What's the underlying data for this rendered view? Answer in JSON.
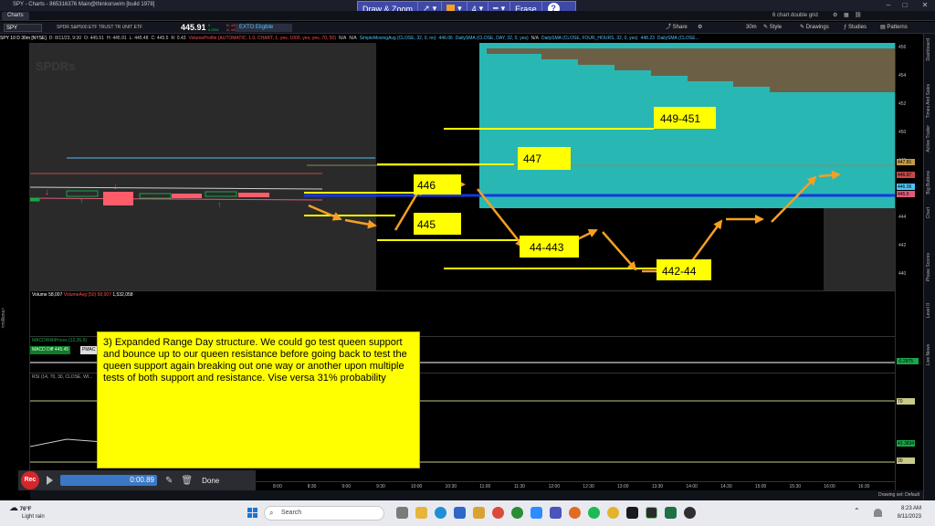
{
  "window": {
    "title": "SPY - Charts - 865316376 Main@thinkorswim [build 1978]"
  },
  "tabs": {
    "active": "Charts",
    "grid_label": "6 chart double grid"
  },
  "drawbar": {
    "label": "Draw & Zoom",
    "size": "4",
    "erase": "Erase",
    "help": "?"
  },
  "symbolbar": {
    "symbol": "SPY",
    "description": "SPDR S&P500 ETF TRUST TR UNIT ETF",
    "price": "445.91",
    "change": "0",
    "change_pct": "0.00%",
    "bid": "B: 445.92",
    "ask": "A: 445.93",
    "exto": "EXTO Eligible",
    "timeframe": "30m",
    "share": "Share",
    "style": "Style",
    "drawings": "Drawings",
    "studies": "Studies",
    "patterns": "Patterns"
  },
  "studies_header": [
    {
      "text": "SPY 10 D 30m [NYSE]",
      "color": "#ffffff"
    },
    {
      "text": "D: 8/11/23, 9:30",
      "color": "#cccccc"
    },
    {
      "text": "O: 445.51",
      "color": "#cccccc"
    },
    {
      "text": "H: 445.91",
      "color": "#cccccc"
    },
    {
      "text": "L: 445.48",
      "color": "#cccccc"
    },
    {
      "text": "C: 445.5",
      "color": "#cccccc"
    },
    {
      "text": "R: 0.43",
      "color": "#cccccc"
    },
    {
      "text": "VolumeProfile (AUTOMATIC, 1.0, CHART, 1, yes, 1000, yes, yes, 70, 50)",
      "color": "#ff5050"
    },
    {
      "text": "N/A",
      "color": "#cccccc"
    },
    {
      "text": "N/A",
      "color": "#cccccc"
    },
    {
      "text": "SimpleMovingAvg (CLOSE, 32, 0, no)",
      "color": "#4fc3f7"
    },
    {
      "text": "446.06",
      "color": "#4fc3f7"
    },
    {
      "text": "DailySMA (CLOSE, DAY, 32, 0, yes)",
      "color": "#4fc3f7"
    },
    {
      "text": "N/A",
      "color": "#cccccc"
    },
    {
      "text": "DailySMA (CLOSE, FOUR_HOURS, 32, 0, yes)",
      "color": "#4fc3f7"
    },
    {
      "text": "448.23",
      "color": "#4fc3f7"
    },
    {
      "text": "DailySMA (CLOSE...",
      "color": "#4fc3f7"
    }
  ],
  "price_axis": {
    "ticks": [
      "456",
      "454",
      "452",
      "450",
      "448",
      "446",
      "444",
      "442",
      "440"
    ],
    "markers": [
      {
        "text": "447.81",
        "color": "#c49a4a"
      },
      {
        "text": "446.87",
        "color": "#c44a4a"
      },
      {
        "text": "446.06",
        "color": "#4fc3f7"
      },
      {
        "text": "445.5",
        "color": "#e05a7a"
      }
    ]
  },
  "annotations": {
    "levels": [
      "449-451",
      "447",
      "446",
      "445",
      "44-443",
      "442-44"
    ]
  },
  "volume_panel": {
    "label": "Volume",
    "value": "58,007",
    "avg_label": "VolumeAvg (50)",
    "avg_value": "58,007",
    "avg2": "1,532,058",
    "ticks": [
      "10",
      "0"
    ]
  },
  "macd_panel": {
    "label": "MACDWithPrices (12,26,9)",
    "buy_label": "MACD Diff 445.45",
    "btn_label": "PMAC",
    "value": "-0.2975",
    "ticks": [
      "2",
      "1",
      "0",
      "-1"
    ]
  },
  "rsi_panel": {
    "label": "RSI (14, 70, 30, CLOSE, WI...",
    "ticks": [
      "80",
      "70",
      "60",
      "50",
      "40",
      "30",
      "20"
    ],
    "markers": [
      "70",
      "43.3834",
      "30"
    ]
  },
  "left_axis": {
    "label": "<millions>"
  },
  "time_axis": [
    "8:00",
    "8:30",
    "9:00",
    "9:30",
    "10:00",
    "10:30",
    "11:00",
    "11:30",
    "12:00",
    "12:30",
    "13:00",
    "13:30",
    "14:00",
    "14:30",
    "15:00",
    "15:30",
    "16:00",
    "16:30"
  ],
  "note": {
    "text": "3) Expanded Range Day structure. We could go test queen support and bounce up to our queen resistance before going back to test the queen support again breaking out one way or another upon multiple tests of both support and resistance.  Vise versa 31% probability"
  },
  "recorder": {
    "rec": "Rec",
    "time": "0:00.89",
    "done": "Done"
  },
  "status": {
    "drawing_set": "Drawing set: Default"
  },
  "right_panel": [
    "Live News",
    "Level II",
    "Phase Scores",
    "Chart",
    "Big Buttons",
    "Active Trader",
    "Times And Sales",
    "Dashboard"
  ],
  "taskbar": {
    "weather_temp": "76°F",
    "weather_desc": "Light rain",
    "search": "Search",
    "time": "8:23 AM",
    "date": "8/11/2023"
  },
  "colors": {
    "note_bg": "#ffff00",
    "teal_area": "#29b7b4",
    "level_line": "#ffff00",
    "arrow": "#f6a021",
    "sma_blue": "#1637e0"
  }
}
